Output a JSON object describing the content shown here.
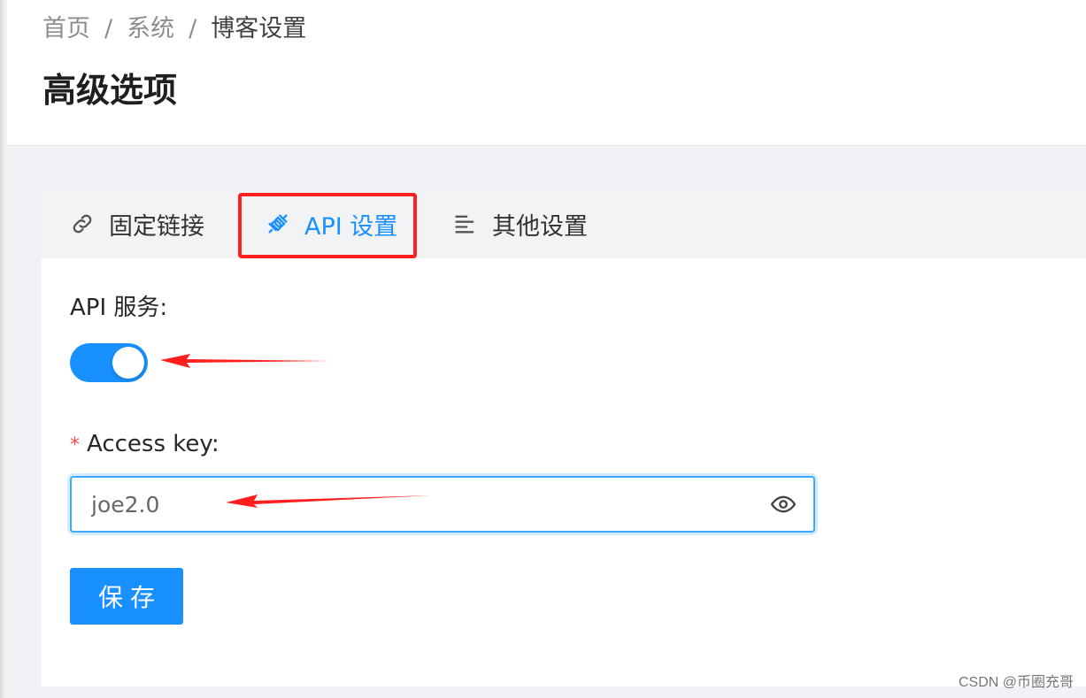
{
  "breadcrumb": {
    "items": [
      "首页",
      "系统",
      "博客设置"
    ],
    "separator": "/"
  },
  "page": {
    "title": "高级选项"
  },
  "tabs": [
    {
      "label": "固定链接",
      "icon": "link-icon",
      "active": false
    },
    {
      "label": "API 设置",
      "icon": "api-plug-icon",
      "active": true
    },
    {
      "label": "其他设置",
      "icon": "align-left-icon",
      "active": false
    }
  ],
  "form": {
    "api_label": "API 服务:",
    "api_enabled": true,
    "key_required_mark": "*",
    "key_label": "Access key:",
    "key_value": "joe2.0",
    "key_toggle_icon": "eye-icon",
    "save_label": "保存"
  },
  "annotations": {
    "highlight_color": "#ff1f1f",
    "arrow_color": "#ff1f1f"
  },
  "colors": {
    "primary": "#1890ff",
    "danger": "#ff4d4f"
  },
  "watermark": "CSDN @币圈充哥"
}
